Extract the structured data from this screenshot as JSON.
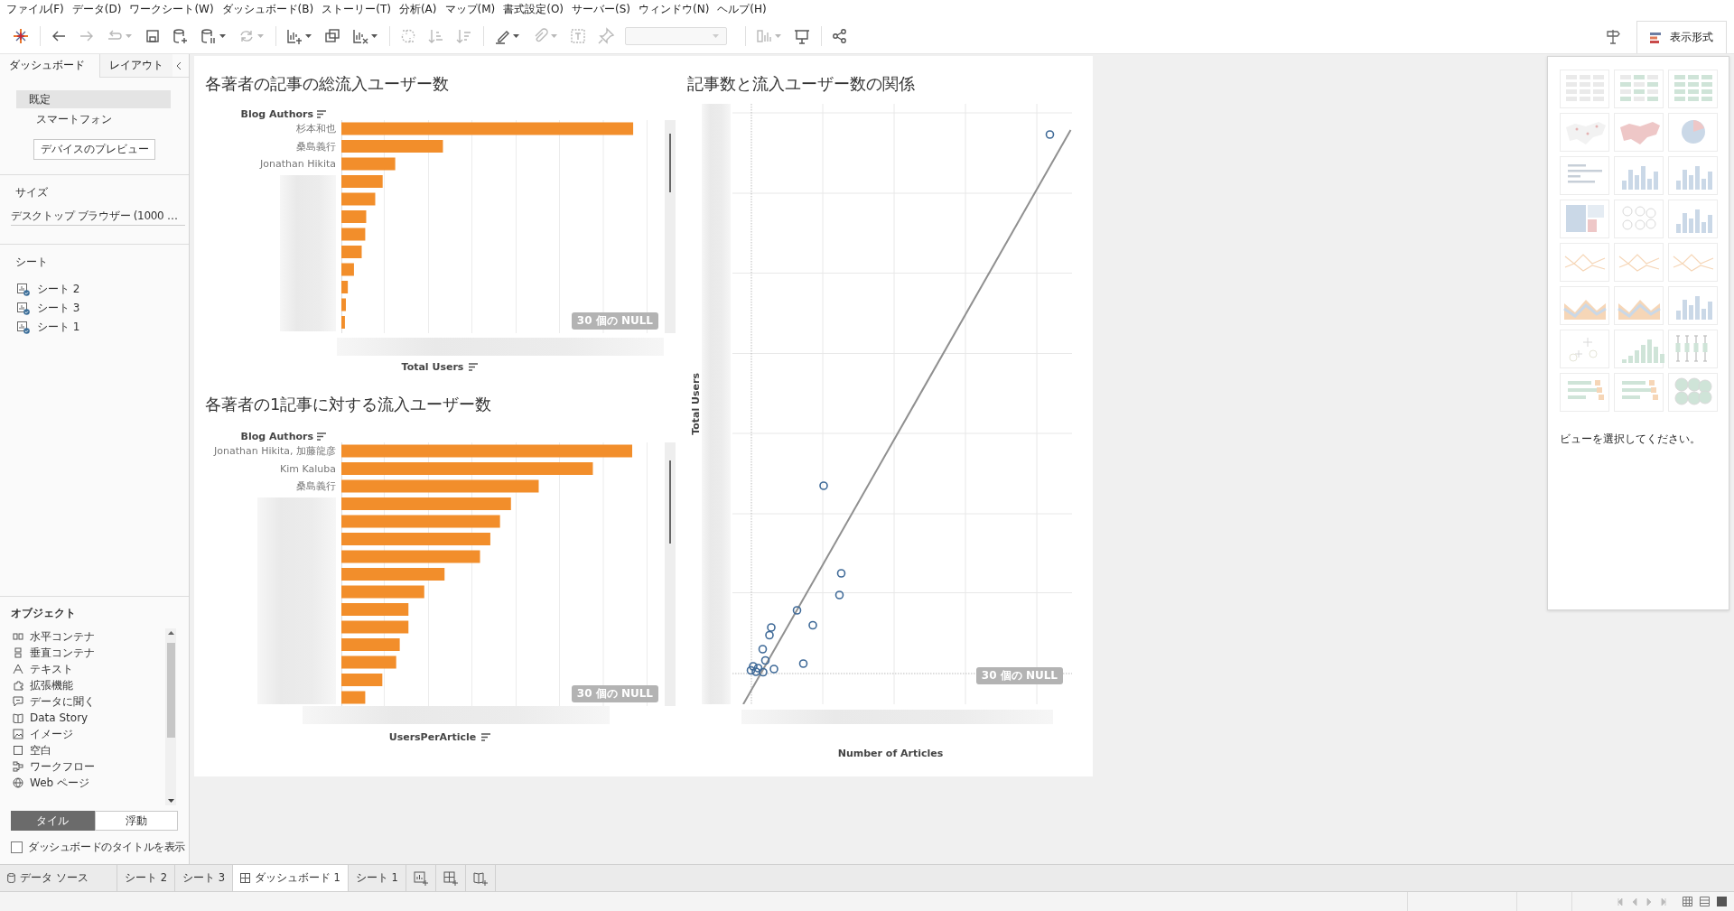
{
  "menu": [
    "ファイル(F)",
    "データ(D)",
    "ワークシート(W)",
    "ダッシュボード(B)",
    "ストーリー(T)",
    "分析(A)",
    "マップ(M)",
    "書式設定(O)",
    "サーバー(S)",
    "ウィンドウ(N)",
    "ヘルプ(H)"
  ],
  "show_me_tab": {
    "label": "表示形式",
    "selected": true
  },
  "left_panel": {
    "tabs": [
      {
        "label": "ダッシュボード",
        "selected": true
      },
      {
        "label": "レイアウト",
        "selected": false
      }
    ],
    "devices": [
      {
        "label": "既定",
        "selected": true
      },
      {
        "label": "スマートフォン",
        "selected": false
      }
    ],
    "preview_button": "デバイスのプレビュー",
    "size": {
      "heading": "サイズ",
      "value": "デスクトップ ブラウザー (1000 …"
    },
    "sheets": {
      "heading": "シート",
      "items": [
        "シート 2",
        "シート 3",
        "シート 1"
      ]
    },
    "objects": {
      "heading": "オブジェクト",
      "items": [
        "水平コンテナ",
        "垂直コンテナ",
        "テキスト",
        "拡張機能",
        "データに聞く",
        "Data Story",
        "イメージ",
        "空白",
        "ワークフロー",
        "Web ページ"
      ]
    },
    "layout_modes": [
      {
        "label": "タイル",
        "selected": true
      },
      {
        "label": "浮動",
        "selected": false
      }
    ],
    "show_title": {
      "label": "ダッシュボードのタイトルを表示",
      "checked": false
    }
  },
  "dashboard": {
    "bar_charts": [
      {
        "title": "各著者の記事の総流入ユーザー数",
        "axis_header": "Blog Authors",
        "labels": [
          "杉本和也",
          "桑島義行",
          "Jonathan Hikita"
        ],
        "null_badge": "30 個の NULL",
        "xlabel": "Total Users"
      },
      {
        "title": "各著者の1記事に対する流入ユーザー数",
        "axis_header": "Blog Authors",
        "labels": [
          "Jonathan Hikita, 加藤龍彦",
          "Kim Kaluba",
          "桑島義行"
        ],
        "null_badge": "30 個の NULL",
        "xlabel": "UsersPerArticle"
      }
    ],
    "scatter": {
      "title": "記事数と流入ユーザー数の関係",
      "ylabel": "Total Users",
      "xlabel": "Number of Articles",
      "null_badge": "30 個の NULL"
    }
  },
  "show_me": {
    "hint": "ビューを選択してください。"
  },
  "sheet_tabs": [
    {
      "label": "データ ソース",
      "kind": "datasource",
      "selected": false
    },
    {
      "label": "シート 2",
      "kind": "sheet",
      "selected": false
    },
    {
      "label": "シート 3",
      "kind": "sheet",
      "selected": false
    },
    {
      "label": "ダッシュボード 1",
      "kind": "dashboard",
      "selected": true
    },
    {
      "label": "シート 1",
      "kind": "sheet",
      "selected": false
    }
  ]
}
